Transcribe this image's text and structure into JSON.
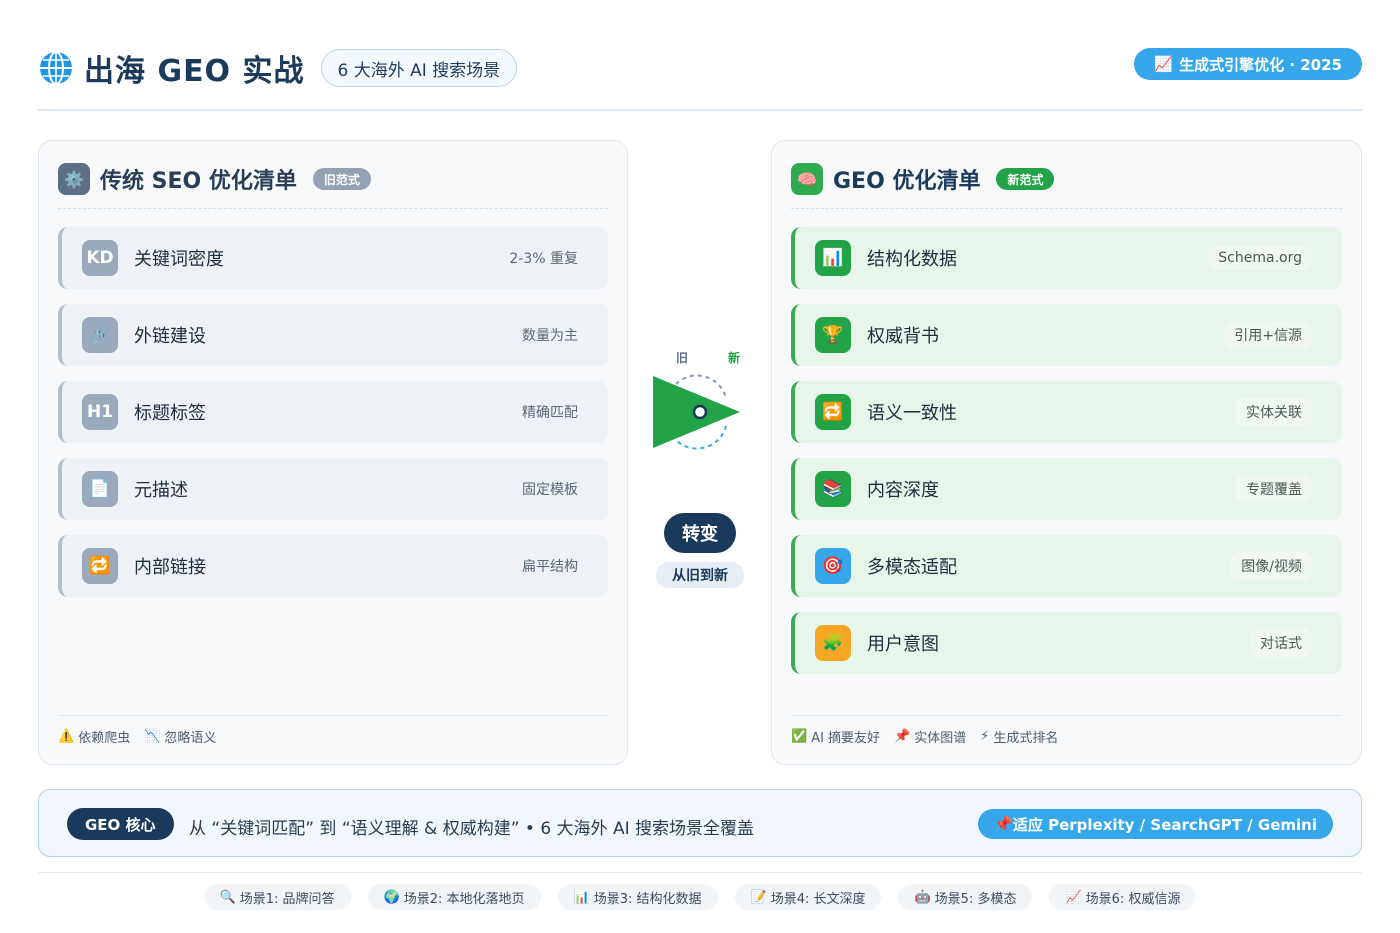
{
  "header": {
    "globe_icon": "globe-icon",
    "title": "出海 GEO 实战",
    "subtitle": "6 大海外 AI 搜索场景",
    "year_icon": "📈",
    "year_label": "生成式引擎优化 · 2025"
  },
  "left_panel": {
    "icon": "⚙️",
    "title": "传统 SEO 优化清单",
    "badge": "旧范式",
    "items": [
      {
        "icon": "KD",
        "label": "关键词密度",
        "tag": "2-3% 重复"
      },
      {
        "icon": "🔗",
        "label": "外链建设",
        "tag": "数量为主"
      },
      {
        "icon": "H1",
        "label": "标题标签",
        "tag": "精确匹配"
      },
      {
        "icon": "📄",
        "label": "元描述",
        "tag": "固定模板"
      },
      {
        "icon": "🔁",
        "label": "内部链接",
        "tag": "扁平结构"
      }
    ],
    "footer": [
      {
        "icon": "⚠️",
        "text": "依赖爬虫"
      },
      {
        "icon": "📉",
        "text": "忽略语义"
      }
    ]
  },
  "right_panel": {
    "icon": "🧠",
    "title": "GEO 优化清单",
    "badge": "新范式",
    "items": [
      {
        "icon": "📊",
        "label": "结构化数据",
        "tag": "Schema.org",
        "color": "#22a347"
      },
      {
        "icon": "🏆",
        "label": "权威背书",
        "tag": "引用+信源",
        "color": "#22a347"
      },
      {
        "icon": "🔁",
        "label": "语义一致性",
        "tag": "实体关联",
        "color": "#22a347"
      },
      {
        "icon": "📚",
        "label": "内容深度",
        "tag": "专题覆盖",
        "color": "#22a347"
      },
      {
        "icon": "🎯",
        "label": "多模态适配",
        "tag": "图像/视频",
        "color": "#35a7ea"
      },
      {
        "icon": "🧩",
        "label": "用户意图",
        "tag": "对话式",
        "color": "#f5a623"
      }
    ],
    "footer": [
      {
        "icon": "✅",
        "text": "AI 摘要友好"
      },
      {
        "icon": "📌",
        "text": "实体图谱"
      },
      {
        "icon": "⚡",
        "text": "生成式排名"
      }
    ]
  },
  "middle": {
    "old_label": "旧",
    "new_label": "新",
    "transform_label": "转变",
    "transform_sub": "从旧到新"
  },
  "core": {
    "pill": "GEO 核心",
    "text": "从 “关键词匹配” 到 “语义理解 & 权威构建”   •  6 大海外 AI 搜索场景全覆盖",
    "right_icon": "📌",
    "right_label": "适应 Perplexity / SearchGPT / Gemini"
  },
  "scenes": [
    {
      "icon": "🔍",
      "label": "场景1: 品牌问答"
    },
    {
      "icon": "🌍",
      "label": "场景2: 本地化落地页"
    },
    {
      "icon": "📊",
      "label": "场景3: 结构化数据"
    },
    {
      "icon": "📝",
      "label": "场景4: 长文深度"
    },
    {
      "icon": "🤖",
      "label": "场景5: 多模态"
    },
    {
      "icon": "📈",
      "label": "场景6: 权威信源"
    }
  ],
  "colors": {
    "navy": "#1a3a5c",
    "green": "#22a347",
    "blue": "#35a7ea"
  }
}
